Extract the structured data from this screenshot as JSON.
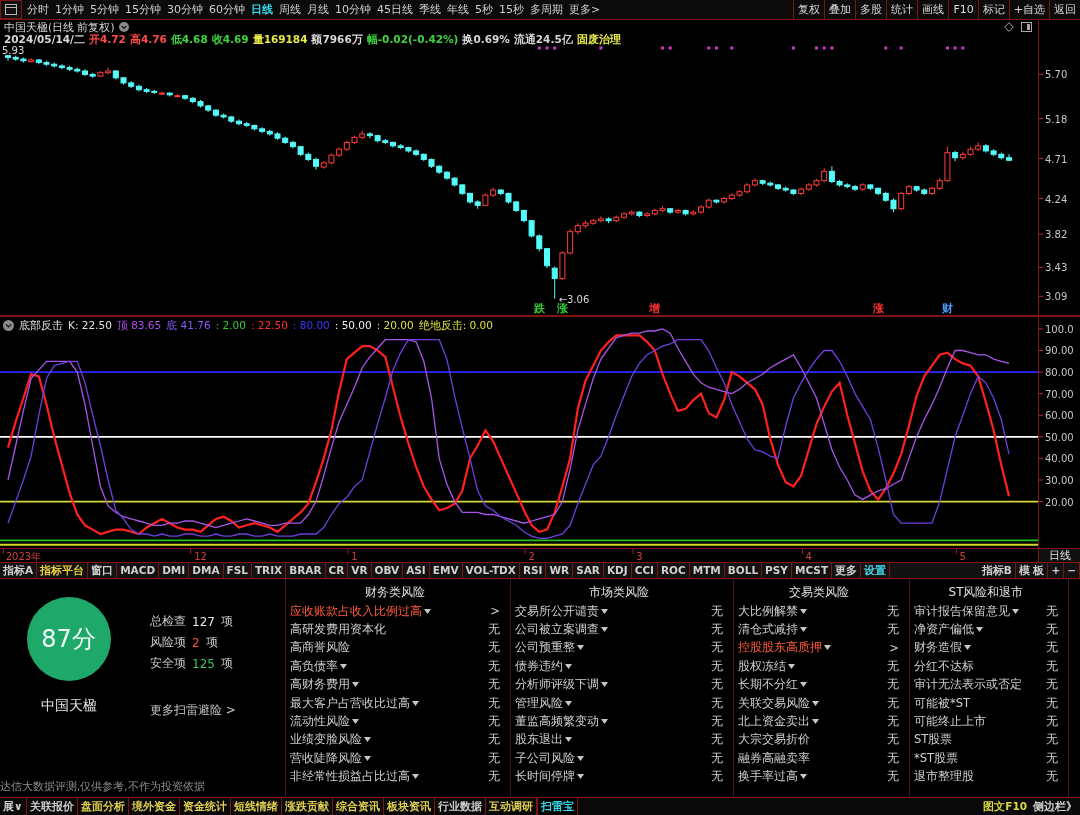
{
  "toolbar": {
    "periods": [
      {
        "label": "分时",
        "selected": false
      },
      {
        "label": "1分钟",
        "selected": false
      },
      {
        "label": "5分钟",
        "selected": false
      },
      {
        "label": "15分钟",
        "selected": false
      },
      {
        "label": "30分钟",
        "selected": false
      },
      {
        "label": "60分钟",
        "selected": false
      },
      {
        "label": "日线",
        "selected": true
      },
      {
        "label": "周线",
        "selected": false
      },
      {
        "label": "月线",
        "selected": false
      },
      {
        "label": "10分钟",
        "selected": false
      },
      {
        "label": "45日线",
        "selected": false
      },
      {
        "label": "季线",
        "selected": false
      },
      {
        "label": "年线",
        "selected": false
      },
      {
        "label": "5秒",
        "selected": false
      },
      {
        "label": "15秒",
        "selected": false
      },
      {
        "label": "多周期",
        "selected": false
      }
    ],
    "more": "更多>",
    "actions": [
      "复权",
      "叠加",
      "多股",
      "统计",
      "画线",
      "F10",
      "标记",
      "+自选",
      "返回"
    ]
  },
  "quote": {
    "title": "中国天楹(日线 前复权)",
    "fields": [
      {
        "text": "2024/05/14/二",
        "color": "#d8d8d8"
      },
      {
        "text": "开4.72",
        "color": "#ff4a4a"
      },
      {
        "text": "高4.76",
        "color": "#ff4a4a"
      },
      {
        "text": "低4.68",
        "color": "#3fd43f"
      },
      {
        "text": "收4.69",
        "color": "#3fd43f"
      },
      {
        "text": "量169184",
        "color": "#e8e84a"
      },
      {
        "text": "额7966万",
        "color": "#d8d8d8"
      },
      {
        "text": "幅-0.02(-0.42%)",
        "color": "#3fd43f"
      },
      {
        "text": "换0.69%",
        "color": "#d8d8d8"
      },
      {
        "text": "流通24.5亿",
        "color": "#d8d8d8"
      },
      {
        "text": "固废治理",
        "color": "#e8e84a"
      }
    ]
  },
  "price": {
    "event_labels": [
      {
        "label": "跌",
        "color": "#33cc33"
      },
      {
        "label": "涨",
        "color": "#33cc33"
      },
      {
        "label": "增",
        "color": "#ff3030"
      },
      {
        "label": "涨",
        "color": "#ff3030"
      },
      {
        "label": "财",
        "color": "#4aa0ff"
      }
    ],
    "chart_data": [
      {
        "type": "candlestick",
        "ylim": [
          2.87,
          6.34
        ],
        "yticks": [
          3.09,
          3.43,
          3.82,
          4.24,
          4.71,
          5.18,
          {
            "value": 5.7,
            "label": "5.70"
          }
        ],
        "ohlc": [
          [
            5.92,
            5.93,
            5.86,
            5.9
          ],
          [
            5.9,
            5.92,
            5.86,
            5.88
          ],
          [
            5.88,
            5.9,
            5.84,
            5.86
          ],
          [
            5.85,
            5.89,
            5.84,
            5.87
          ],
          [
            5.87,
            5.88,
            5.82,
            5.84
          ],
          [
            5.84,
            5.86,
            5.8,
            5.82
          ],
          [
            5.82,
            5.84,
            5.78,
            5.8
          ],
          [
            5.8,
            5.82,
            5.76,
            5.78
          ],
          [
            5.78,
            5.8,
            5.74,
            5.76
          ],
          [
            5.76,
            5.78,
            5.72,
            5.74
          ],
          [
            5.74,
            5.76,
            5.68,
            5.7
          ],
          [
            5.7,
            5.72,
            5.66,
            5.68
          ],
          [
            5.68,
            5.74,
            5.67,
            5.72
          ],
          [
            5.72,
            5.78,
            5.7,
            5.74
          ],
          [
            5.74,
            5.75,
            5.64,
            5.66
          ],
          [
            5.66,
            5.67,
            5.58,
            5.6
          ],
          [
            5.6,
            5.62,
            5.54,
            5.56
          ],
          [
            5.56,
            5.58,
            5.5,
            5.52
          ],
          [
            5.52,
            5.54,
            5.48,
            5.5
          ],
          [
            5.5,
            5.52,
            5.47,
            5.49
          ],
          [
            5.47,
            5.5,
            5.46,
            5.48
          ],
          [
            5.48,
            5.49,
            5.44,
            5.46
          ],
          [
            5.44,
            5.47,
            5.43,
            5.45
          ],
          [
            5.45,
            5.46,
            5.4,
            5.42
          ],
          [
            5.42,
            5.43,
            5.36,
            5.38
          ],
          [
            5.38,
            5.4,
            5.31,
            5.33
          ],
          [
            5.33,
            5.34,
            5.26,
            5.28
          ],
          [
            5.28,
            5.29,
            5.2,
            5.22
          ],
          [
            5.22,
            5.24,
            5.18,
            5.2
          ],
          [
            5.2,
            5.21,
            5.13,
            5.15
          ],
          [
            5.15,
            5.17,
            5.1,
            5.12
          ],
          [
            5.12,
            5.14,
            5.08,
            5.1
          ],
          [
            5.1,
            5.11,
            5.04,
            5.06
          ],
          [
            5.06,
            5.08,
            5.01,
            5.03
          ],
          [
            5.03,
            5.05,
            4.98,
            5.0
          ],
          [
            5.0,
            5.02,
            4.93,
            4.95
          ],
          [
            4.95,
            4.97,
            4.88,
            4.9
          ],
          [
            4.9,
            4.92,
            4.83,
            4.85
          ],
          [
            4.85,
            4.86,
            4.74,
            4.76
          ],
          [
            4.76,
            4.78,
            4.68,
            4.7
          ],
          [
            4.7,
            4.72,
            4.58,
            4.62
          ],
          [
            4.61,
            4.68,
            4.59,
            4.66
          ],
          [
            4.66,
            4.77,
            4.64,
            4.75
          ],
          [
            4.75,
            4.84,
            4.73,
            4.82
          ],
          [
            4.82,
            4.92,
            4.8,
            4.9
          ],
          [
            4.9,
            4.98,
            4.88,
            4.96
          ],
          [
            4.96,
            5.04,
            4.94,
            5.0
          ],
          [
            5.0,
            5.02,
            4.95,
            4.98
          ],
          [
            4.98,
            4.99,
            4.9,
            4.92
          ],
          [
            4.92,
            4.94,
            4.88,
            4.9
          ],
          [
            4.9,
            4.91,
            4.84,
            4.86
          ],
          [
            4.86,
            4.88,
            4.82,
            4.84
          ],
          [
            4.84,
            4.85,
            4.78,
            4.8
          ],
          [
            4.8,
            4.82,
            4.74,
            4.76
          ],
          [
            4.76,
            4.77,
            4.68,
            4.7
          ],
          [
            4.7,
            4.71,
            4.6,
            4.62
          ],
          [
            4.62,
            4.63,
            4.53,
            4.55
          ],
          [
            4.55,
            4.56,
            4.46,
            4.48
          ],
          [
            4.48,
            4.49,
            4.38,
            4.4
          ],
          [
            4.4,
            4.41,
            4.28,
            4.3
          ],
          [
            4.3,
            4.31,
            4.18,
            4.2
          ],
          [
            4.2,
            4.22,
            4.12,
            4.16
          ],
          [
            4.16,
            4.3,
            4.15,
            4.28
          ],
          [
            4.28,
            4.37,
            4.26,
            4.34
          ],
          [
            4.34,
            4.35,
            4.28,
            4.3
          ],
          [
            4.3,
            4.31,
            4.18,
            4.2
          ],
          [
            4.2,
            4.21,
            4.08,
            4.1
          ],
          [
            4.1,
            4.11,
            3.96,
            3.98
          ],
          [
            3.98,
            3.99,
            3.78,
            3.8
          ],
          [
            3.8,
            3.82,
            3.62,
            3.65
          ],
          [
            3.65,
            3.66,
            3.42,
            3.45
          ],
          [
            3.42,
            3.44,
            3.06,
            3.3
          ],
          [
            3.3,
            3.62,
            3.28,
            3.6
          ],
          [
            3.6,
            3.88,
            3.58,
            3.85
          ],
          [
            3.85,
            3.95,
            3.82,
            3.92
          ],
          [
            3.92,
            3.98,
            3.89,
            3.95
          ],
          [
            3.95,
            4.0,
            3.93,
            3.98
          ],
          [
            3.98,
            4.03,
            3.96,
            4.0
          ],
          [
            4.0,
            4.02,
            3.95,
            3.98
          ],
          [
            3.98,
            4.04,
            3.96,
            4.02
          ],
          [
            4.02,
            4.08,
            4.0,
            4.06
          ],
          [
            4.06,
            4.1,
            4.04,
            4.08
          ],
          [
            4.08,
            4.09,
            4.02,
            4.04
          ],
          [
            4.04,
            4.08,
            4.02,
            4.06
          ],
          [
            4.06,
            4.12,
            4.04,
            4.1
          ],
          [
            4.1,
            4.15,
            4.08,
            4.12
          ],
          [
            4.12,
            4.13,
            4.06,
            4.08
          ],
          [
            4.08,
            4.12,
            4.06,
            4.1
          ],
          [
            4.1,
            4.11,
            4.04,
            4.06
          ],
          [
            4.06,
            4.1,
            4.04,
            4.08
          ],
          [
            4.08,
            4.16,
            4.06,
            4.14
          ],
          [
            4.14,
            4.24,
            4.12,
            4.22
          ],
          [
            4.22,
            4.23,
            4.18,
            4.2
          ],
          [
            4.2,
            4.26,
            4.18,
            4.24
          ],
          [
            4.24,
            4.3,
            4.22,
            4.28
          ],
          [
            4.28,
            4.34,
            4.26,
            4.32
          ],
          [
            4.32,
            4.42,
            4.3,
            4.4
          ],
          [
            4.4,
            4.48,
            4.38,
            4.45
          ],
          [
            4.45,
            4.46,
            4.4,
            4.42
          ],
          [
            4.42,
            4.44,
            4.38,
            4.4
          ],
          [
            4.4,
            4.41,
            4.34,
            4.36
          ],
          [
            4.36,
            4.38,
            4.32,
            4.34
          ],
          [
            4.34,
            4.35,
            4.28,
            4.3
          ],
          [
            4.3,
            4.37,
            4.28,
            4.35
          ],
          [
            4.35,
            4.42,
            4.33,
            4.4
          ],
          [
            4.4,
            4.47,
            4.38,
            4.45
          ],
          [
            4.45,
            4.6,
            4.43,
            4.56
          ],
          [
            4.56,
            4.62,
            4.42,
            4.44
          ],
          [
            4.44,
            4.46,
            4.38,
            4.4
          ],
          [
            4.4,
            4.42,
            4.36,
            4.38
          ],
          [
            4.38,
            4.4,
            4.33,
            4.35
          ],
          [
            4.35,
            4.42,
            4.33,
            4.4
          ],
          [
            4.4,
            4.41,
            4.34,
            4.36
          ],
          [
            4.36,
            4.37,
            4.28,
            4.3
          ],
          [
            4.3,
            4.32,
            4.2,
            4.22
          ],
          [
            4.22,
            4.24,
            4.08,
            4.12
          ],
          [
            4.12,
            4.32,
            4.1,
            4.3
          ],
          [
            4.3,
            4.4,
            4.28,
            4.38
          ],
          [
            4.38,
            4.39,
            4.32,
            4.34
          ],
          [
            4.34,
            4.36,
            4.28,
            4.3
          ],
          [
            4.3,
            4.38,
            4.28,
            4.36
          ],
          [
            4.36,
            4.48,
            4.34,
            4.45
          ],
          [
            4.45,
            4.85,
            4.44,
            4.78
          ],
          [
            4.78,
            4.8,
            4.68,
            4.72
          ],
          [
            4.72,
            4.79,
            4.7,
            4.76
          ],
          [
            4.76,
            4.85,
            4.74,
            4.82
          ],
          [
            4.82,
            4.9,
            4.8,
            4.86
          ],
          [
            4.86,
            4.88,
            4.78,
            4.8
          ],
          [
            4.8,
            4.82,
            4.74,
            4.76
          ],
          [
            4.76,
            4.78,
            4.7,
            4.72
          ],
          [
            4.72,
            4.76,
            4.68,
            4.69
          ]
        ],
        "annotations": [
          "5.93",
          "←3.06"
        ]
      }
    ]
  },
  "indicator": {
    "title": "底部反击",
    "legend": [
      {
        "text": "K: 22.50",
        "color": "#e0e0e0"
      },
      {
        "text": "顶 83.65",
        "color": "#b050f0"
      },
      {
        "text": "底 41.76",
        "color": "#8a5cff"
      },
      {
        "text": ": 2.00",
        "color": "#30d030"
      },
      {
        "text": ": 22.50",
        "color": "#ff3030"
      },
      {
        "text": ": 80.00",
        "color": "#3a3aff"
      },
      {
        "text": ": 50.00",
        "color": "#f0f0f0"
      },
      {
        "text": ": 20.00",
        "color": "#e0e040"
      },
      {
        "text": "绝地反击: 0.00",
        "color": "#e0e040"
      }
    ],
    "chart_data": [
      {
        "type": "line",
        "ylim": [
          -1.5,
          105.5
        ],
        "yticks": [
          {
            "value": 20,
            "label": "20.00"
          },
          {
            "value": 30,
            "label": "30.00"
          },
          {
            "value": 40,
            "label": "40.00"
          },
          {
            "value": 50,
            "label": "50.00"
          },
          {
            "value": 60,
            "label": "60.00"
          },
          {
            "value": 70,
            "label": "70.00"
          },
          {
            "value": 80,
            "label": "80.00"
          },
          {
            "value": 90,
            "label": "90.00"
          },
          {
            "value": 100,
            "label": "100.0"
          }
        ],
        "categories": [
          null,
          null,
          "2023年",
          null,
          null,
          null,
          null,
          null,
          null,
          null,
          null,
          null,
          null,
          null,
          null,
          null,
          null,
          null,
          null,
          null,
          null,
          null,
          null,
          null,
          null,
          "12",
          null,
          null,
          null,
          null,
          null,
          null,
          null,
          null,
          null,
          null,
          null,
          null,
          null,
          null,
          null,
          null,
          null,
          null,
          null,
          "1",
          null,
          null,
          null,
          null,
          null,
          null,
          null,
          null,
          null,
          null,
          null,
          null,
          null,
          null,
          null,
          null,
          null,
          null,
          null,
          null,
          null,
          null,
          "2",
          null,
          null,
          null,
          null,
          null,
          null,
          null,
          null,
          null,
          null,
          null,
          null,
          null,
          "3",
          null,
          null,
          null,
          null,
          null,
          null,
          null,
          null,
          null,
          null,
          null,
          null,
          null,
          null,
          null,
          null,
          null,
          null,
          null,
          null,
          null,
          "4",
          null,
          null,
          null,
          null,
          null,
          null,
          null,
          null,
          null,
          null,
          null,
          null,
          null,
          null,
          null,
          null,
          null,
          null,
          null,
          "5",
          null,
          null,
          null,
          null,
          null,
          null
        ],
        "series": [
          {
            "color": "#ff2020",
            "values": [
              45,
              57,
              68,
              79,
              78,
              65,
              50,
              37,
              24,
              14,
              9,
              7,
              5,
              6,
              7,
              7,
              6,
              5,
              8,
              10,
              12,
              10,
              8,
              7,
              7,
              6,
              9,
              12,
              13,
              11,
              8,
              9,
              10,
              9,
              8,
              6,
              9,
              12,
              15,
              19,
              29,
              40,
              53,
              71,
              86,
              89,
              92,
              92,
              90,
              87,
              73,
              59,
              47,
              36,
              27,
              21,
              16,
              17,
              19,
              25,
              40,
              46,
              53,
              48,
              40,
              32,
              24,
              16,
              9,
              6,
              7,
              15,
              27,
              40,
              63,
              76,
              83,
              90,
              94,
              97,
              97,
              97,
              97,
              94,
              90,
              79,
              70,
              62,
              63,
              67,
              70,
              61,
              59,
              67,
              80,
              78,
              75,
              72,
              65,
              49,
              37,
              29,
              27,
              32,
              44,
              56,
              64,
              71,
              75,
              60,
              47,
              34,
              25,
              21,
              26,
              33,
              42,
              55,
              69,
              78,
              83,
              88,
              89,
              86,
              84,
              83,
              78,
              66,
              53,
              37,
              22.5
            ]
          },
          {
            "color": "#a855e8",
            "values": [
              30,
              46,
              62,
              77,
              81,
              85,
              85,
              85,
              85,
              80,
              65,
              46,
              27,
              18,
              15,
              13,
              12,
              11,
              10,
              9,
              9,
              10,
              10,
              11,
              11,
              10,
              9,
              8,
              9,
              10,
              11,
              12,
              11,
              10,
              9,
              9,
              10,
              10,
              10,
              14,
              20,
              32,
              45,
              57,
              65,
              73,
              82,
              87,
              91,
              95,
              95,
              95,
              95,
              94,
              85,
              68,
              40,
              28,
              20,
              15,
              15,
              15,
              14,
              14,
              13,
              12,
              11,
              10,
              11,
              12,
              13,
              14,
              20,
              35,
              53,
              65,
              77,
              86,
              91,
              96,
              97,
              98,
              98,
              99,
              99,
              100,
              98,
              91,
              85,
              79,
              75,
              73,
              72,
              71,
              70,
              72,
              75,
              77,
              79,
              82,
              84,
              86,
              88,
              82,
              75,
              68,
              56,
              44,
              36,
              30,
              23,
              21,
              23,
              25,
              26,
              28,
              30,
              40,
              50,
              58,
              65,
              73,
              82,
              90,
              90,
              89,
              88,
              88,
              86,
              85,
              84
            ]
          },
          {
            "color": "#6f3fe0",
            "values": [
              10,
              20,
              30,
              41,
              60,
              77,
              83,
              84,
              85,
              85,
              75,
              60,
              46,
              30,
              16,
              12,
              7,
              5,
              5,
              4,
              5,
              4,
              4,
              5,
              5,
              4,
              4,
              5,
              4,
              4,
              5,
              5,
              4,
              4,
              5,
              4,
              4,
              4,
              5,
              5,
              5,
              8,
              14,
              19,
              22,
              27,
              30,
              43,
              56,
              68,
              81,
              89,
              95,
              95,
              95,
              95,
              95,
              86,
              69,
              54,
              40,
              25,
              18,
              16,
              13,
              11,
              9,
              6,
              4,
              3,
              3,
              4,
              5,
              9,
              19,
              28,
              37,
              41,
              50,
              60,
              69,
              78,
              84,
              88,
              90,
              92,
              93,
              95,
              95,
              95,
              95,
              90,
              82,
              75,
              65,
              57,
              49,
              44,
              43,
              41,
              40,
              55,
              68,
              75,
              81,
              86,
              90,
              90,
              85,
              78,
              70,
              64,
              58,
              45,
              30,
              14,
              10,
              10,
              10,
              10,
              10,
              20,
              35,
              50,
              60,
              70,
              78,
              75,
              68,
              58,
              42
            ]
          }
        ],
        "ref_lines": [
          {
            "axis": "y",
            "value": 80,
            "color": "#2828ff"
          },
          {
            "axis": "y",
            "value": 50,
            "color": "#ffffff"
          },
          {
            "axis": "y",
            "value": 20,
            "color": "#d8d840"
          },
          {
            "axis": "y",
            "value": 2,
            "color": "#20c020"
          },
          {
            "axis": "y",
            "value": 0,
            "color": "#d8d820"
          }
        ]
      }
    ]
  },
  "period_label": "日线",
  "indicator_tabs": {
    "left": [
      {
        "label": "指标A",
        "color": "#d0d0d0"
      },
      {
        "label": "指标平台",
        "color": "#e8d040"
      },
      {
        "label": "窗口",
        "color": "#d0d0d0"
      },
      {
        "label": "MACD",
        "color": "#d0d0d0"
      },
      {
        "label": "DMI",
        "color": "#d0d0d0"
      },
      {
        "label": "DMA",
        "color": "#d0d0d0"
      },
      {
        "label": "FSL",
        "color": "#d0d0d0"
      },
      {
        "label": "TRIX",
        "color": "#d0d0d0"
      },
      {
        "label": "BRAR",
        "color": "#d0d0d0"
      },
      {
        "label": "CR",
        "color": "#d0d0d0"
      },
      {
        "label": "VR",
        "color": "#d0d0d0"
      },
      {
        "label": "OBV",
        "color": "#d0d0d0"
      },
      {
        "label": "ASI",
        "color": "#d0d0d0"
      },
      {
        "label": "EMV",
        "color": "#d0d0d0"
      },
      {
        "label": "VOL-TDX",
        "color": "#d0d0d0"
      },
      {
        "label": "RSI",
        "color": "#d0d0d0"
      },
      {
        "label": "WR",
        "color": "#d0d0d0"
      },
      {
        "label": "SAR",
        "color": "#d0d0d0"
      },
      {
        "label": "KDJ",
        "color": "#d0d0d0"
      },
      {
        "label": "CCI",
        "color": "#d0d0d0"
      },
      {
        "label": "ROC",
        "color": "#d0d0d0"
      },
      {
        "label": "MTM",
        "color": "#d0d0d0"
      },
      {
        "label": "BOLL",
        "color": "#d0d0d0"
      },
      {
        "label": "PSY",
        "color": "#d0d0d0"
      },
      {
        "label": "MCST",
        "color": "#d0d0d0"
      },
      {
        "label": "更多",
        "color": "#d0d0d0"
      },
      {
        "label": "设置",
        "color": "#40d8e8"
      }
    ],
    "right": [
      {
        "label": "指标B"
      },
      {
        "label": "模 板"
      },
      {
        "label": "+"
      },
      {
        "label": "−"
      }
    ]
  },
  "scan": {
    "score": "87分",
    "stock": "中国天楹",
    "stats": [
      {
        "label": "总检查",
        "count": "127",
        "unit": "项",
        "kind": "total"
      },
      {
        "label": "风险项",
        "count": "2",
        "unit": "项",
        "kind": "risk"
      },
      {
        "label": "安全项",
        "count": "125",
        "unit": "项",
        "kind": "safe"
      }
    ],
    "more": "更多扫雷避险 >",
    "disclaimer": "达信大数据评测,仅供参考,不作为投资依据",
    "columns": [
      {
        "title": "财务类风险",
        "rows": [
          {
            "label": "应收账款占收入比例过高",
            "dropdown": true,
            "risk": true,
            "result": ">"
          },
          {
            "label": "高研发费用资本化",
            "dropdown": false,
            "risk": false,
            "result": "无"
          },
          {
            "label": "高商誉风险",
            "dropdown": false,
            "risk": false,
            "result": "无"
          },
          {
            "label": "高负债率",
            "dropdown": true,
            "risk": false,
            "result": "无"
          },
          {
            "label": "高财务费用",
            "dropdown": true,
            "risk": false,
            "result": "无"
          },
          {
            "label": "最大客户占营收比过高",
            "dropdown": true,
            "risk": false,
            "result": "无"
          },
          {
            "label": "流动性风险",
            "dropdown": true,
            "risk": false,
            "result": "无"
          },
          {
            "label": "业绩变脸风险",
            "dropdown": true,
            "risk": false,
            "result": "无"
          },
          {
            "label": "营收陡降风险",
            "dropdown": true,
            "risk": false,
            "result": "无"
          },
          {
            "label": "非经常性损益占比过高",
            "dropdown": true,
            "risk": false,
            "result": "无"
          }
        ]
      },
      {
        "title": "市场类风险",
        "rows": [
          {
            "label": "交易所公开谴责",
            "dropdown": true,
            "risk": false,
            "result": "无"
          },
          {
            "label": "公司被立案调查",
            "dropdown": true,
            "risk": false,
            "result": "无"
          },
          {
            "label": "公司预重整",
            "dropdown": true,
            "risk": false,
            "result": "无"
          },
          {
            "label": "债券违约",
            "dropdown": true,
            "risk": false,
            "result": "无"
          },
          {
            "label": "分析师评级下调",
            "dropdown": true,
            "risk": false,
            "result": "无"
          },
          {
            "label": "管理风险",
            "dropdown": true,
            "risk": false,
            "result": "无"
          },
          {
            "label": "董监高频繁变动",
            "dropdown": true,
            "risk": false,
            "result": "无"
          },
          {
            "label": "股东退出",
            "dropdown": true,
            "risk": false,
            "result": "无"
          },
          {
            "label": "子公司风险",
            "dropdown": true,
            "risk": false,
            "result": "无"
          },
          {
            "label": "长时间停牌",
            "dropdown": true,
            "risk": false,
            "result": "无"
          }
        ]
      },
      {
        "title": "交易类风险",
        "rows": [
          {
            "label": "大比例解禁",
            "dropdown": true,
            "risk": false,
            "result": "无"
          },
          {
            "label": "清仓式减持",
            "dropdown": true,
            "risk": false,
            "result": "无"
          },
          {
            "label": "控股股东高质押",
            "dropdown": true,
            "risk": true,
            "result": ">"
          },
          {
            "label": "股权冻结",
            "dropdown": true,
            "risk": false,
            "result": "无"
          },
          {
            "label": "长期不分红",
            "dropdown": true,
            "risk": false,
            "result": "无"
          },
          {
            "label": "关联交易风险",
            "dropdown": true,
            "risk": false,
            "result": "无"
          },
          {
            "label": "北上资金卖出",
            "dropdown": true,
            "risk": false,
            "result": "无"
          },
          {
            "label": "大宗交易折价",
            "dropdown": false,
            "risk": false,
            "result": "无"
          },
          {
            "label": "融券高融卖率",
            "dropdown": false,
            "risk": false,
            "result": "无"
          },
          {
            "label": "换手率过高",
            "dropdown": true,
            "risk": false,
            "result": "无"
          }
        ]
      },
      {
        "title": "ST风险和退市",
        "rows": [
          {
            "label": "审计报告保留意见",
            "dropdown": true,
            "risk": false,
            "result": "无"
          },
          {
            "label": "净资产偏低",
            "dropdown": true,
            "risk": false,
            "result": "无"
          },
          {
            "label": "财务造假",
            "dropdown": true,
            "risk": false,
            "result": "无"
          },
          {
            "label": "分红不达标",
            "dropdown": false,
            "risk": false,
            "result": "无"
          },
          {
            "label": "审计无法表示或否定",
            "dropdown": false,
            "risk": false,
            "result": "无"
          },
          {
            "label": "可能被*ST",
            "dropdown": false,
            "risk": false,
            "result": "无"
          },
          {
            "label": "可能终止上市",
            "dropdown": false,
            "risk": false,
            "result": "无"
          },
          {
            "label": "ST股票",
            "dropdown": false,
            "risk": false,
            "result": "无"
          },
          {
            "label": "*ST股票",
            "dropdown": false,
            "risk": false,
            "result": "无"
          },
          {
            "label": "退市整理股",
            "dropdown": false,
            "risk": false,
            "result": "无"
          }
        ]
      }
    ]
  },
  "status_bar": {
    "tabs": [
      {
        "label": "展∨",
        "selected": false,
        "color": "#d0d0d0"
      },
      {
        "label": "关联报价",
        "selected": false,
        "color": "#d0d0d0"
      },
      {
        "label": "盘面分析",
        "selected": false,
        "color": "#e0d050"
      },
      {
        "label": "境外资金",
        "selected": false,
        "color": "#e0d050"
      },
      {
        "label": "资金统计",
        "selected": false,
        "color": "#e0d050"
      },
      {
        "label": "短线情绪",
        "selected": false,
        "color": "#e0d050"
      },
      {
        "label": "涨跌贡献",
        "selected": false,
        "color": "#e0d050"
      },
      {
        "label": "综合资讯",
        "selected": false,
        "color": "#e0d050"
      },
      {
        "label": "板块资讯",
        "selected": false,
        "color": "#e0d050"
      },
      {
        "label": "行业数据",
        "selected": false,
        "color": "#d0d0d0"
      },
      {
        "label": "互动调研",
        "selected": false,
        "color": "#e0d050"
      },
      {
        "label": "扫雷宝",
        "selected": true,
        "color": "#38d8e8"
      }
    ],
    "right": [
      {
        "text": "图文F10",
        "color": "#d8d840"
      },
      {
        "text": "侧边栏》",
        "color": "#d0d0d0"
      }
    ]
  }
}
